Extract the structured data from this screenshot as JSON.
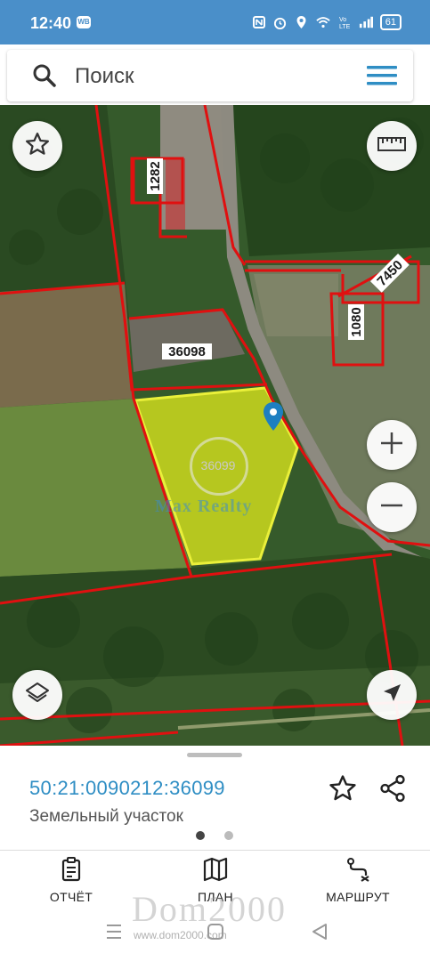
{
  "status_bar": {
    "time": "12:40",
    "badge": "WB",
    "battery": "61",
    "icons": [
      "nfc-icon",
      "alarm-icon",
      "location-icon",
      "wifi-icon",
      "volte-icon",
      "signal-icon",
      "battery-icon"
    ]
  },
  "search": {
    "placeholder": "Поиск",
    "icon": "search-icon",
    "menu_icon": "hamburger-menu-icon"
  },
  "map": {
    "parcel_labels": {
      "p1282": "1282",
      "p7450": "7450",
      "p1080": "1080",
      "p36098": "36098",
      "p36099": "36099"
    },
    "watermark": "Max Realty",
    "highlight_color": "#d7e21d",
    "boundary_color": "#e01010",
    "buttons": {
      "favorite": "star-icon",
      "ruler": "ruler-icon",
      "zoom_in": "+",
      "zoom_out": "−",
      "layers": "layers-icon",
      "locate": "navigation-arrow-icon"
    }
  },
  "bottom_sheet": {
    "cadastral_number": "50:21:0090212:36099",
    "object_type": "Земельный участок",
    "page_indicator": {
      "total": 2,
      "active": 1
    }
  },
  "bottom_nav": {
    "items": [
      {
        "label": "ОТЧЁТ",
        "icon": "report-icon"
      },
      {
        "label": "ПЛАН",
        "icon": "map-plan-icon"
      },
      {
        "label": "МАРШРУТ",
        "icon": "route-icon"
      }
    ]
  },
  "watermarks": {
    "brand": "Dom2000",
    "url": "www.dom2000.com"
  },
  "accent_color": "#2f8ec4",
  "status_bar_color": "#4a8fc9"
}
